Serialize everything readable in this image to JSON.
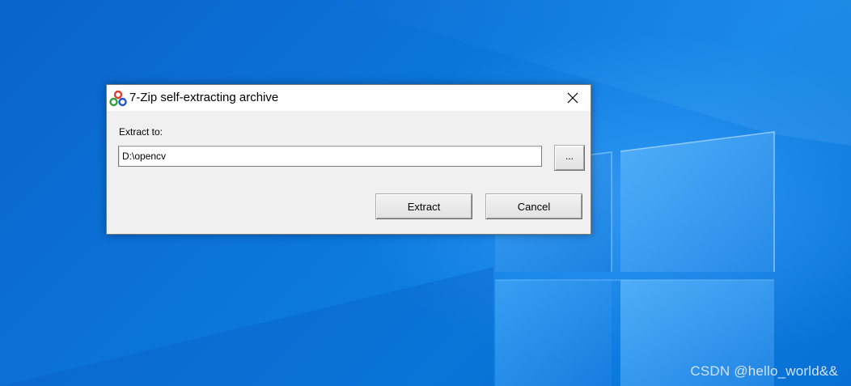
{
  "dialog": {
    "title": "7-Zip self-extracting archive",
    "extract_to_label": "Extract to:",
    "path_value": "D:\\opencv",
    "browse_label": "...",
    "extract_label": "Extract",
    "cancel_label": "Cancel",
    "icons": {
      "app": "7zip-sfx-icon",
      "close": "close-icon"
    }
  },
  "desktop": {
    "watermark": "CSDN @hello_world&&",
    "accent_color": "#0b74da"
  }
}
